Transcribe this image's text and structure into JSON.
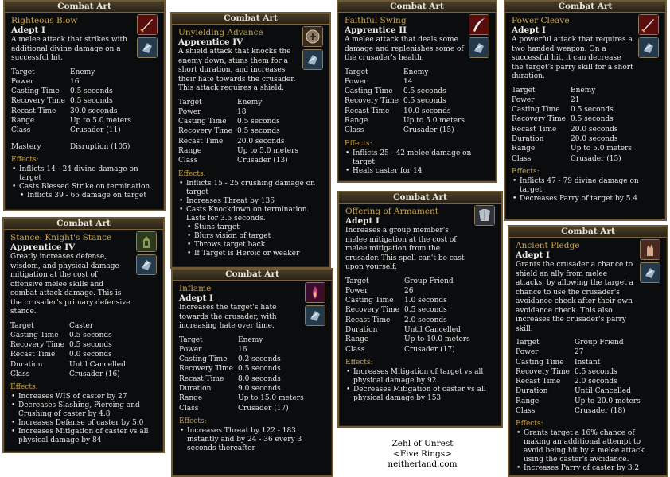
{
  "cards": [
    {
      "header": "Combat Art",
      "name": "Righteous Blow",
      "rank": "Adept I",
      "description": "A melee attack that strikes with additional divine damage on a successful hit.",
      "stats": [
        {
          "k": "Target",
          "v": "Enemy"
        },
        {
          "k": "Power",
          "v": "16"
        },
        {
          "k": "Casting Time",
          "v": "0.5 seconds"
        },
        {
          "k": "Recovery Time",
          "v": "0.5 seconds"
        },
        {
          "k": "Recast Time",
          "v": "30.0 seconds"
        },
        {
          "k": "Range",
          "v": "Up to 5.0 meters"
        },
        {
          "k": "Class",
          "v": "Crusader (11)"
        },
        {
          "k": "Mastery",
          "v": "Disruption (105)"
        }
      ],
      "effects_title": "Effects:",
      "effects": [
        {
          "t": "Inflicts 14 - 24 divine damage on target"
        },
        {
          "t": "Casts Blessed Strike on termination."
        },
        {
          "t": "Inflicts 39 - 65 damage on target",
          "sub": true
        }
      ]
    },
    {
      "header": "Combat Art",
      "name": "Unyielding Advance",
      "rank": "Apprentice IV",
      "description": "A shield attack that knocks the enemy down, stuns them for a short duration, and increases their hate towards the crusader. This attack requires a shield.",
      "stats": [
        {
          "k": "Target",
          "v": "Enemy"
        },
        {
          "k": "Power",
          "v": "18"
        },
        {
          "k": "Casting Time",
          "v": "0.5 seconds"
        },
        {
          "k": "Recovery Time",
          "v": "0.5 seconds"
        },
        {
          "k": "Recast Time",
          "v": "20.0 seconds"
        },
        {
          "k": "Range",
          "v": "Up to 5.0 meters"
        },
        {
          "k": "Class",
          "v": "Crusader (13)"
        }
      ],
      "effects_title": "Effects:",
      "effects": [
        {
          "t": "Inflicts 15 - 25 crushing damage on target"
        },
        {
          "t": "Increases Threat by 136"
        },
        {
          "t": "Casts Knockdown on termination.  Lasts for 3.5 seconds."
        },
        {
          "t": "Stuns target",
          "sub": true
        },
        {
          "t": "Blurs vision of target",
          "sub": true
        },
        {
          "t": "Throws target back",
          "sub": true
        },
        {
          "t": "If Target is Heroic or weaker",
          "sub": true
        }
      ]
    },
    {
      "header": "Combat Art",
      "name": "Faithful Swing",
      "rank": "Apprentice II",
      "description": "A melee attack that deals some damage and replenishes some of the crusader's health.",
      "stats": [
        {
          "k": "Target",
          "v": "Enemy"
        },
        {
          "k": "Power",
          "v": "14"
        },
        {
          "k": "Casting Time",
          "v": "0.5 seconds"
        },
        {
          "k": "Recovery Time",
          "v": "0.5 seconds"
        },
        {
          "k": "Recast Time",
          "v": "10.0 seconds"
        },
        {
          "k": "Range",
          "v": "Up to 5.0 meters"
        },
        {
          "k": "Class",
          "v": "Crusader (15)"
        }
      ],
      "effects_title": "Effects:",
      "effects": [
        {
          "t": "Inflicts 25 - 42 melee damage on target"
        },
        {
          "t": "Heals caster for 14"
        }
      ]
    },
    {
      "header": "Combat Art",
      "name": "Power Cleave",
      "rank": "Adept I",
      "description": "A powerful attack that requires a two handed weapon. On a successful hit, it can decrease the target's parry skill for a short duration.",
      "stats": [
        {
          "k": "Target",
          "v": "Enemy"
        },
        {
          "k": "Power",
          "v": "21"
        },
        {
          "k": "Casting Time",
          "v": "0.5 seconds"
        },
        {
          "k": "Recovery Time",
          "v": "0.5 seconds"
        },
        {
          "k": "Recast Time",
          "v": "20.0 seconds"
        },
        {
          "k": "Duration",
          "v": "20.0 seconds"
        },
        {
          "k": "Range",
          "v": "Up to 5.0 meters"
        },
        {
          "k": "Class",
          "v": "Crusader (15)"
        }
      ],
      "effects_title": "Effects:",
      "effects": [
        {
          "t": "Inflicts 47 - 79 divine damage on target"
        },
        {
          "t": "Decreases Parry of target by 5.4"
        }
      ]
    },
    {
      "header": "Combat Art",
      "name": "Stance: Knight's Stance",
      "rank": "Apprentice IV",
      "description": "Greatly increases defense, wisdom, and physical damage mitigation at the cost of offensive melee skills and combat attack damage. This is the crusader's primary defensive stance.",
      "stats": [
        {
          "k": "Target",
          "v": "Caster"
        },
        {
          "k": "Casting Time",
          "v": "0.5 seconds"
        },
        {
          "k": "Recovery Time",
          "v": "0.5 seconds"
        },
        {
          "k": "Recast Time",
          "v": "0.0 seconds"
        },
        {
          "k": "Duration",
          "v": "Until Cancelled"
        },
        {
          "k": "Class",
          "v": "Crusader (16)"
        }
      ],
      "effects_title": "Effects:",
      "effects": [
        {
          "t": "Increases WIS of caster by 27"
        },
        {
          "t": "Decreases Slashing, Piercing and Crushing of caster by 4.8"
        },
        {
          "t": "Increases Defense of caster by 5.0"
        },
        {
          "t": "Increases Mitigation of caster vs all physical damage by 84"
        }
      ]
    },
    {
      "header": "Combat Art",
      "name": "Inflame",
      "rank": "Adept I",
      "description": "Increases the target's hate towards the crusader, with increasing hate over time.",
      "stats": [
        {
          "k": "Target",
          "v": "Enemy"
        },
        {
          "k": "Power",
          "v": "16"
        },
        {
          "k": "Casting Time",
          "v": "0.2 seconds"
        },
        {
          "k": "Recovery Time",
          "v": "0.5 seconds"
        },
        {
          "k": "Recast Time",
          "v": "8.0 seconds"
        },
        {
          "k": "Duration",
          "v": "9.0 seconds"
        },
        {
          "k": "Range",
          "v": "Up to 15.0 meters"
        },
        {
          "k": "Class",
          "v": "Crusader (17)"
        }
      ],
      "effects_title": "Effects:",
      "effects": [
        {
          "t": "Increases Threat by 122 - 183 instantly and by 24 - 36 every 3 seconds thereafter"
        }
      ]
    },
    {
      "header": "Combat Art",
      "name": "Offering of Armament",
      "rank": "Adept I",
      "description": "Increases a group member's melee mitigation at the cost of melee mitigation from the crusader.  This spell can't be cast upon yourself.",
      "stats": [
        {
          "k": "Target",
          "v": "Group Friend"
        },
        {
          "k": "Power",
          "v": "26"
        },
        {
          "k": "Casting Time",
          "v": "1.0 seconds"
        },
        {
          "k": "Recovery Time",
          "v": "0.5 seconds"
        },
        {
          "k": "Recast Time",
          "v": "2.0 seconds"
        },
        {
          "k": "Duration",
          "v": "Until Cancelled"
        },
        {
          "k": "Range",
          "v": "Up to 10.0 meters"
        },
        {
          "k": "Class",
          "v": "Crusader (17)"
        }
      ],
      "effects_title": "Effects:",
      "effects": [
        {
          "t": "Increases Mitigation of target vs all physical damage by 92"
        },
        {
          "t": "Decreases Mitigation of caster vs all physical damage by 153"
        }
      ]
    },
    {
      "header": "Combat Art",
      "name": "Ancient Pledge",
      "rank": "Adept I",
      "description": "Grants the crusader a chance to shield an ally from melee attacks, by allowing the target a chance to use the crusader's avoidance check after their own avoidance check. This also increases the crusader's parry skill.",
      "stats": [
        {
          "k": "Target",
          "v": "Group Friend"
        },
        {
          "k": "Power",
          "v": "27"
        },
        {
          "k": "Casting Time",
          "v": "Instant"
        },
        {
          "k": "Recovery Time",
          "v": "0.5 seconds"
        },
        {
          "k": "Recast Time",
          "v": "2.0 seconds"
        },
        {
          "k": "Duration",
          "v": "Until Cancelled"
        },
        {
          "k": "Range",
          "v": "Up to 20.0 meters"
        },
        {
          "k": "Class",
          "v": "Crusader (18)"
        }
      ],
      "effects_title": "Effects:",
      "effects": [
        {
          "t": "Grants target a 16% chance of making an additional attempt to avoid being hit by a melee attack using the caster's avoidance."
        },
        {
          "t": "Increases Parry of caster by 3.2"
        }
      ]
    }
  ],
  "signature": {
    "line1": "Zehl of Unrest",
    "line2": "<Five Rings>",
    "line3": "neitherland.com"
  },
  "icons": [
    "sword-icon",
    "gauntlet-icon",
    "shield-bash-icon",
    "scimitar-icon",
    "knight-stance-icon",
    "flame-icon",
    "armor-icon",
    "pledge-hand-icon"
  ]
}
